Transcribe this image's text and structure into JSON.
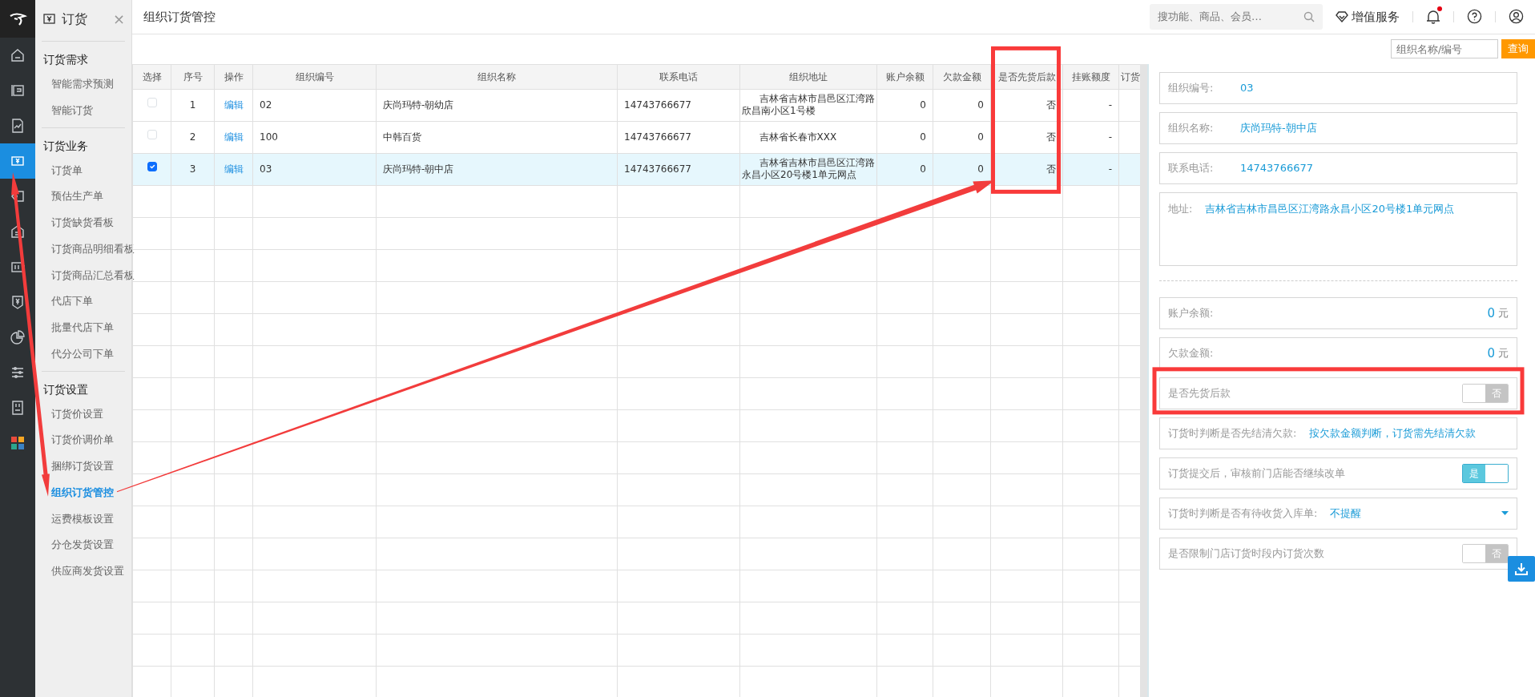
{
  "page_title": "组织订货管控",
  "topbar": {
    "search_placeholder": "搜功能、商品、会员…",
    "service": "增值服务",
    "notification_dot": true
  },
  "rail": [
    {
      "selected": false
    },
    {
      "selected": false
    },
    {
      "selected": false
    },
    {
      "selected": true
    },
    {
      "selected": false
    },
    {
      "selected": false
    },
    {
      "selected": false
    },
    {
      "selected": false
    },
    {
      "selected": false
    },
    {
      "selected": false
    },
    {
      "selected": false
    },
    {
      "selected": false
    }
  ],
  "sidebar": {
    "title": "订货",
    "close": "×",
    "groups": [
      {
        "title": "订货需求",
        "items": [
          {
            "label": "智能需求预测",
            "selected": false
          },
          {
            "label": "智能订货",
            "selected": false
          }
        ]
      },
      {
        "title": "订货业务",
        "items": [
          {
            "label": "订货单",
            "selected": false
          },
          {
            "label": "预估生产单",
            "selected": false
          },
          {
            "label": "订货缺货看板",
            "selected": false
          },
          {
            "label": "订货商品明细看板",
            "selected": false
          },
          {
            "label": "订货商品汇总看板",
            "selected": false
          },
          {
            "label": "代店下单",
            "selected": false
          },
          {
            "label": "批量代店下单",
            "selected": false
          },
          {
            "label": "代分公司下单",
            "selected": false
          }
        ]
      },
      {
        "title": "订货设置",
        "items": [
          {
            "label": "订货价设置",
            "selected": false
          },
          {
            "label": "订货价调价单",
            "selected": false
          },
          {
            "label": "捆绑订货设置",
            "selected": false
          },
          {
            "label": "组织订货管控",
            "selected": true
          },
          {
            "label": "运费模板设置",
            "selected": false
          },
          {
            "label": "分仓发货设置",
            "selected": false
          },
          {
            "label": "供应商发货设置",
            "selected": false
          }
        ]
      }
    ]
  },
  "filter": {
    "placeholder": "组织名称/编号",
    "button": "查询"
  },
  "table": {
    "columns": [
      {
        "label": "选择",
        "kind": "check"
      },
      {
        "label": "序号",
        "kind": "center"
      },
      {
        "label": "操作",
        "kind": "link"
      },
      {
        "label": "组织编号",
        "kind": "text"
      },
      {
        "label": "组织名称",
        "kind": "text"
      },
      {
        "label": "联系电话",
        "kind": "text"
      },
      {
        "label": "组织地址",
        "kind": "address"
      },
      {
        "label": "账户余额",
        "kind": "number"
      },
      {
        "label": "欠款金额",
        "kind": "number"
      },
      {
        "label": "是否先货后款",
        "kind": "number"
      },
      {
        "label": "挂账额度",
        "kind": "number"
      },
      {
        "label": "订货",
        "kind": "cut"
      }
    ],
    "rows": [
      {
        "selected": false,
        "checked": false,
        "cells": [
          "",
          "1",
          "编辑",
          "02",
          "庆尚玛特-朝幼店",
          "14743766677",
          "吉林省吉林市昌邑区江湾路欣昌南小区1号楼",
          "0",
          "0",
          "否",
          "-"
        ]
      },
      {
        "selected": false,
        "checked": false,
        "cells": [
          "",
          "2",
          "编辑",
          "100",
          "中韩百货",
          "14743766677",
          "吉林省长春市XXX",
          "0",
          "0",
          "否",
          "-"
        ]
      },
      {
        "selected": true,
        "checked": true,
        "cells": [
          "",
          "3",
          "编辑",
          "03",
          "庆尚玛特-朝中店",
          "14743766677",
          "吉林省吉林市昌邑区江湾路永昌小区20号楼1单元网点",
          "0",
          "0",
          "否",
          "-"
        ]
      }
    ]
  },
  "detail": [
    {
      "kind": "field",
      "label": "组织编号:",
      "value": "03"
    },
    {
      "kind": "field",
      "label": "组织名称:",
      "value": "庆尚玛特-朝中店"
    },
    {
      "kind": "field",
      "label": "联系电话:",
      "value": "14743766677"
    },
    {
      "kind": "address",
      "label": "地址:",
      "value": "吉林省吉林市昌邑区江湾路永昌小区20号楼1单元网点"
    },
    {
      "kind": "divider"
    },
    {
      "kind": "amount",
      "label": "账户余额:",
      "value": "0",
      "unit": "元"
    },
    {
      "kind": "amount",
      "label": "欠款金额:",
      "value": "0",
      "unit": "元"
    },
    {
      "kind": "toggle",
      "label": "是否先货后款",
      "on": false,
      "text": "否"
    },
    {
      "kind": "field",
      "label": "订货时判断是否先结清欠款:",
      "value": "按欠款金额判断，订货需先结清欠款"
    },
    {
      "kind": "toggle",
      "label": "订货提交后，审核前门店能否继续改单",
      "on": true,
      "text": "是"
    },
    {
      "kind": "select",
      "label": "订货时判断是否有待收货入库单:",
      "value": "不提醒"
    },
    {
      "kind": "toggle",
      "label": "是否限制门店订货时段内订货次数",
      "on": false,
      "text": "否"
    }
  ],
  "annotations": [
    {
      "kind": "frame"
    },
    {
      "kind": "frame"
    },
    {
      "kind": "double_arrow"
    },
    {
      "kind": "arrow"
    }
  ]
}
